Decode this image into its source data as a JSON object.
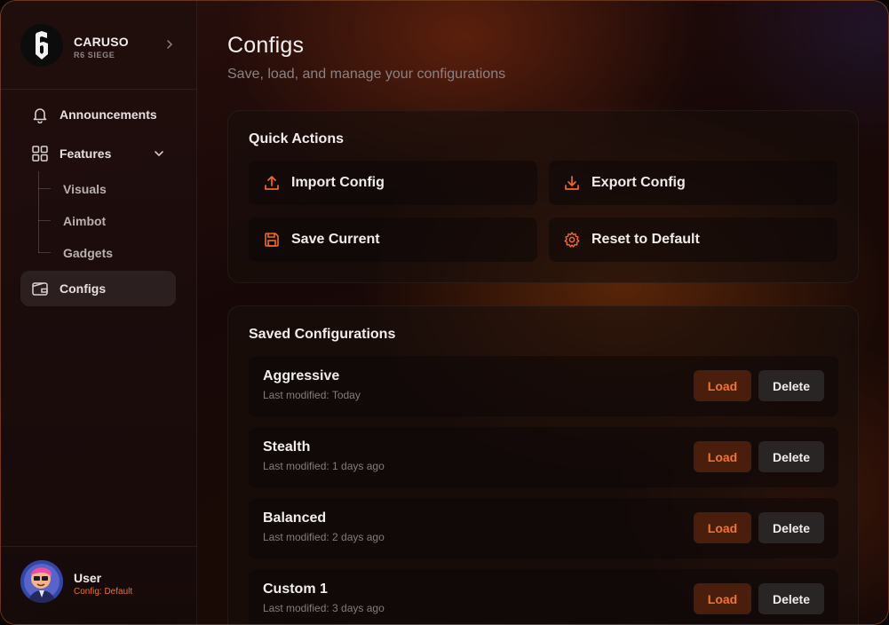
{
  "brand": {
    "name": "CARUSO",
    "subtitle": "R6 SIEGE",
    "logo_icon": "six-logo-icon"
  },
  "sidebar": {
    "items": [
      {
        "label": "Announcements",
        "icon": "bell-icon"
      },
      {
        "label": "Features",
        "icon": "grid-icon",
        "expanded": true,
        "children": [
          {
            "label": "Visuals"
          },
          {
            "label": "Aimbot"
          },
          {
            "label": "Gadgets"
          }
        ]
      },
      {
        "label": "Configs",
        "icon": "wallet-icon",
        "active": true
      }
    ]
  },
  "user": {
    "name": "User",
    "config": "Config: Default"
  },
  "page": {
    "title": "Configs",
    "subtitle": "Save, load, and manage your configurations"
  },
  "quick_actions": {
    "title": "Quick Actions",
    "buttons": [
      {
        "label": "Import Config",
        "icon": "upload-icon"
      },
      {
        "label": "Export Config",
        "icon": "download-icon"
      },
      {
        "label": "Save Current",
        "icon": "save-icon"
      },
      {
        "label": "Reset to Default",
        "icon": "gear-icon"
      }
    ]
  },
  "saved": {
    "title": "Saved Configurations",
    "load_label": "Load",
    "delete_label": "Delete",
    "configs": [
      {
        "name": "Aggressive",
        "modified": "Last modified: Today"
      },
      {
        "name": "Stealth",
        "modified": "Last modified: 1 days ago"
      },
      {
        "name": "Balanced",
        "modified": "Last modified: 2 days ago"
      },
      {
        "name": "Custom 1",
        "modified": "Last modified: 3 days ago"
      }
    ]
  },
  "colors": {
    "accent": "#ee6a2a",
    "load_bg": "#4a1e0c",
    "delete_bg": "#2a2525"
  }
}
